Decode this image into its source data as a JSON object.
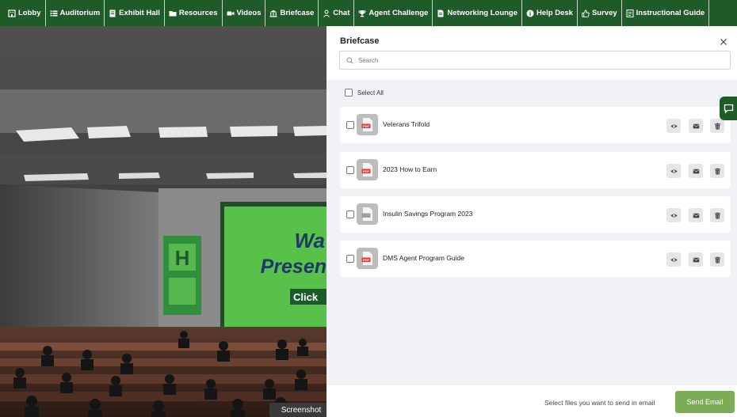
{
  "nav": {
    "items": [
      {
        "label": "Lobby",
        "icon": "building-icon"
      },
      {
        "label": "Auditorium",
        "icon": "list-icon"
      },
      {
        "label": "Exhibit Hall",
        "icon": "booth-icon"
      },
      {
        "label": "Resources",
        "icon": "folder-icon"
      },
      {
        "label": "Videos",
        "icon": "video-icon"
      },
      {
        "label": "Briefcase",
        "icon": "briefcase-icon"
      },
      {
        "label": "Chat",
        "icon": "person-icon"
      },
      {
        "label": "Agent Challenge",
        "icon": "trophy-icon"
      },
      {
        "label": "Networking Lounge",
        "icon": "document-icon"
      },
      {
        "label": "Help Desk",
        "icon": "info-icon"
      },
      {
        "label": "Survey",
        "icon": "thumbs-up-icon"
      },
      {
        "label": "Instructional Guide",
        "icon": "guide-icon"
      }
    ]
  },
  "scene": {
    "screen_text_line1": "Wa",
    "screen_text_line2": "Presen",
    "screen_button": "Click",
    "logo_letter": "H"
  },
  "screenshot_tag": "Screenshot",
  "briefcase": {
    "title": "Briefcase",
    "search_placeholder": "Search",
    "select_all_label": "Select All",
    "files": [
      {
        "name": "Veterans Trifold",
        "type": "pdf",
        "badge": "PDF"
      },
      {
        "name": "2023 How to Earn",
        "type": "pdf",
        "badge": "PDF"
      },
      {
        "name": "Insulin Savings Program 2023",
        "type": "generic",
        "badge": ""
      },
      {
        "name": "DMS Agent Program Guide",
        "type": "pdf",
        "badge": "PDF"
      }
    ],
    "footer_text": "Select files you want to send in email",
    "send_label": "Send Email"
  },
  "colors": {
    "nav_bg": "#1f5b28",
    "send_button": "#7dac57",
    "pdf_red": "#e53935",
    "panel_body_bg": "#f0f2f5"
  }
}
